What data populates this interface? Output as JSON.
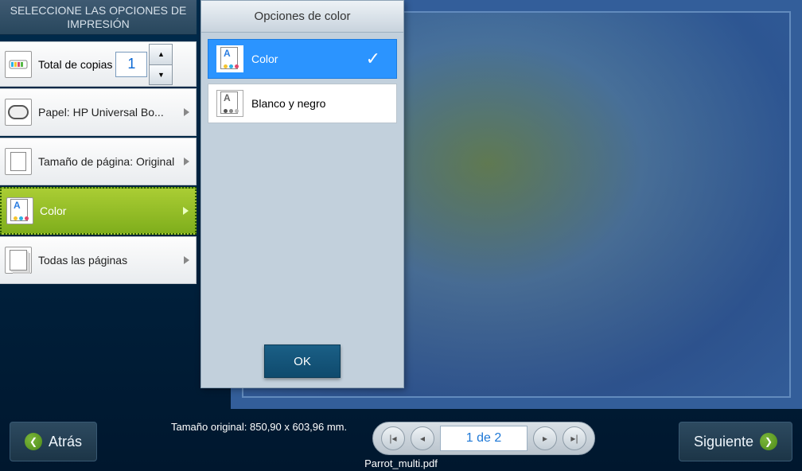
{
  "sidebar": {
    "title": "SELECCIONE LAS OPCIONES DE IMPRESIÓN",
    "copies_label": "Total de copias",
    "copies_value": "1",
    "paper_label": "Papel: HP Universal Bo...",
    "size_label": "Tamaño de página: Original",
    "color_label": "Color",
    "pages_label": "Todas las páginas"
  },
  "color_panel": {
    "title": "Opciones de color",
    "option_color": "Color",
    "option_bw": "Blanco y negro",
    "ok": "OK"
  },
  "footer": {
    "back": "Atrás",
    "next": "Siguiente",
    "orig_size": "Tamaño original: 850,90 x 603,96 mm.",
    "page_label": "1 de 2",
    "filename": "Parrot_multi.pdf"
  }
}
